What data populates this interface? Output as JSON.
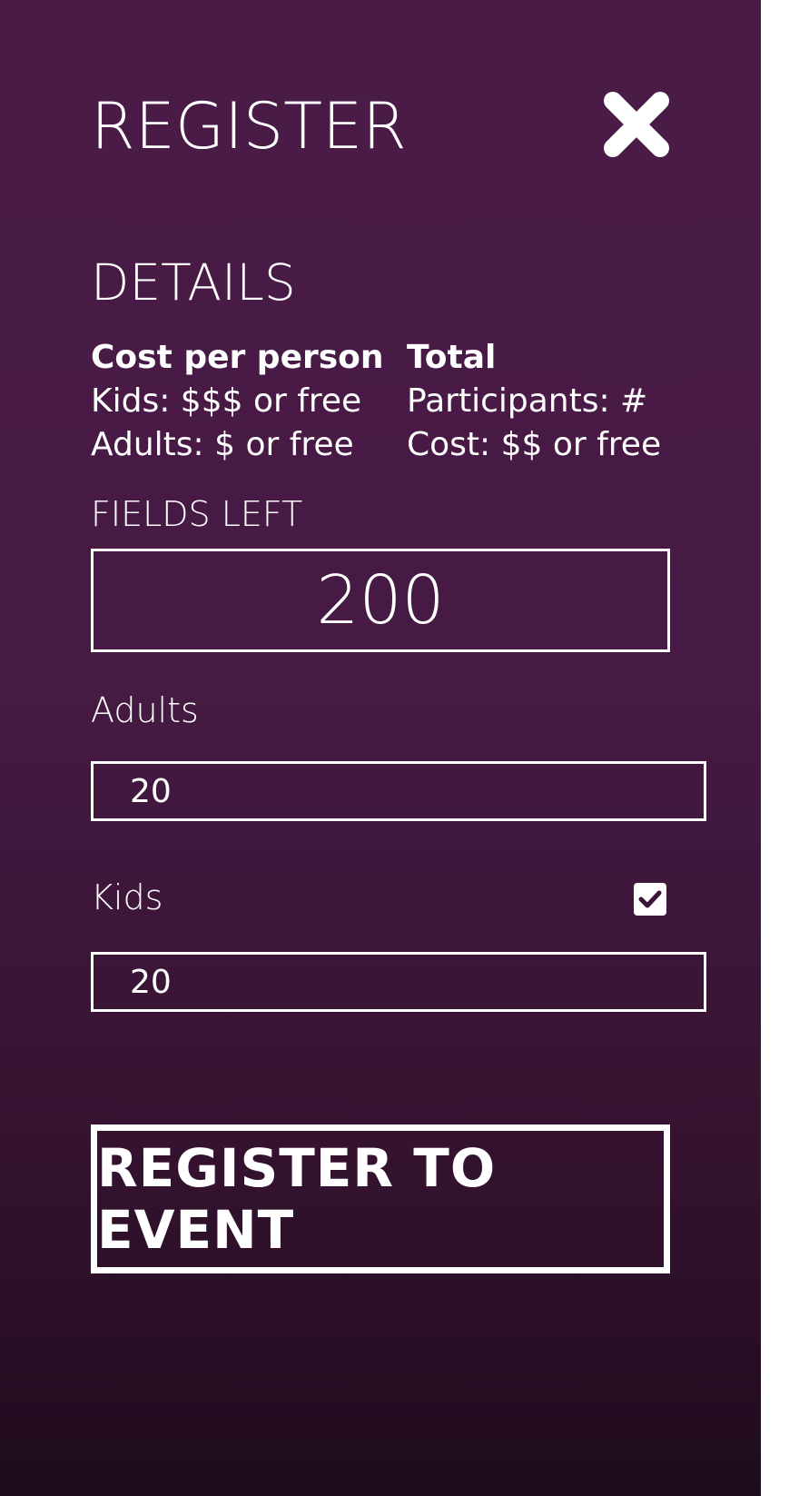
{
  "header": {
    "title": "REGISTER",
    "close_icon": "close-icon"
  },
  "details": {
    "section_title": "DETAILS",
    "cost_per_person": {
      "heading": "Cost per person",
      "kids": "Kids: $$$ or free",
      "adults": "Adults: $ or free"
    },
    "total": {
      "heading": "Total",
      "participants": "Participants: #",
      "cost": "Cost: $$ or free"
    }
  },
  "fields_left": {
    "label": "FIELDS LEFT",
    "value": "200"
  },
  "adults": {
    "label": "Adults",
    "value": "20"
  },
  "kids": {
    "label": "Kids",
    "checked": true,
    "checkbox_icon": "checkmark-icon",
    "value": "20"
  },
  "actions": {
    "register_label": "REGISTER TO EVENT"
  },
  "colors": {
    "background_top": "#4a1b47",
    "background_bottom": "#1f0b1d",
    "foreground": "#ffffff"
  }
}
